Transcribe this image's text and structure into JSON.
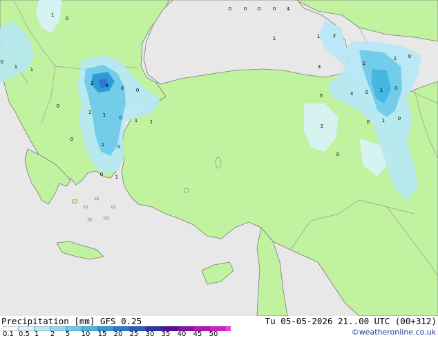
{
  "map": {
    "title": "Precipitation [mm]  GFS 0.25",
    "valid_time": "Tu 05-05-2026 21..00 UTC (00+312)",
    "credit": "©weatheronline.co.uk",
    "colors": {
      "sea": "#e8e8e8",
      "land": "#c0f2a0",
      "border": "#9a9a9a",
      "coast": "#7a7a7a"
    },
    "legend": {
      "labels": [
        "0.1",
        "0.5",
        "1",
        "2",
        "5",
        "10",
        "15",
        "20",
        "25",
        "30",
        "35",
        "40",
        "45",
        "50"
      ],
      "colors": [
        "#f6fbfd",
        "#d8f3fb",
        "#b6e8f7",
        "#92daf2",
        "#6ccae9",
        "#46b7e0",
        "#2f9ad6",
        "#2c7ad0",
        "#2e58c4",
        "#2d35ae",
        "#5310a0",
        "#8a0fb0",
        "#b414c2",
        "#d81cd0",
        "#f23ce0"
      ]
    },
    "values": [
      {
        "text": "1"
      },
      {
        "text": "0"
      },
      {
        "text": "1"
      },
      {
        "text": "1"
      },
      {
        "text": "0"
      },
      {
        "text": "0"
      },
      {
        "text": "0"
      },
      {
        "text": "0"
      },
      {
        "text": "0"
      },
      {
        "text": "4"
      },
      {
        "text": "1"
      },
      {
        "text": "1"
      },
      {
        "text": "2"
      },
      {
        "text": "1"
      },
      {
        "text": "1"
      },
      {
        "text": "0"
      },
      {
        "text": "3"
      },
      {
        "text": "5"
      },
      {
        "text": "3"
      },
      {
        "text": "0"
      },
      {
        "text": "1"
      },
      {
        "text": "0"
      },
      {
        "text": "3"
      },
      {
        "text": "4"
      },
      {
        "text": "0"
      },
      {
        "text": "0"
      },
      {
        "text": "0"
      },
      {
        "text": "1"
      },
      {
        "text": "1"
      },
      {
        "text": "0"
      },
      {
        "text": "1"
      },
      {
        "text": "1"
      },
      {
        "text": "2"
      },
      {
        "text": "0"
      },
      {
        "text": "1"
      },
      {
        "text": "0"
      },
      {
        "text": "0"
      },
      {
        "text": "1"
      },
      {
        "text": "0"
      },
      {
        "text": "0"
      },
      {
        "text": "0"
      },
      {
        "text": "1"
      }
    ]
  }
}
